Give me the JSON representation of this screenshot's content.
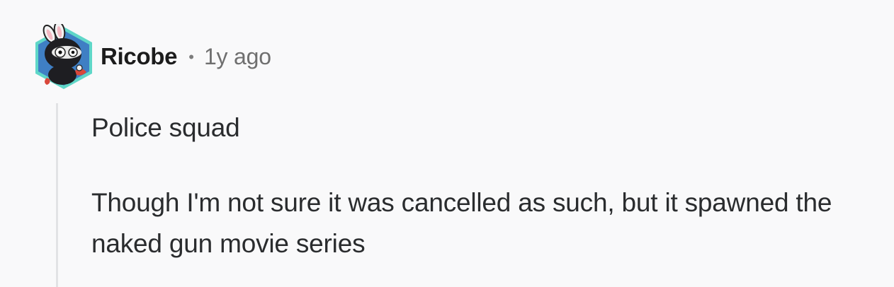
{
  "comment": {
    "author": "Ricobe",
    "separator": "•",
    "timestamp": "1y ago",
    "paragraphs": [
      "Police squad",
      "Though I'm not sure it was cancelled as such, but it spawned the naked gun movie series"
    ]
  },
  "colors": {
    "background": "#f9f9fa",
    "author": "#1c1c1c",
    "meta": "#6f6f6f",
    "body_text": "#2a2c2e",
    "thread_line": "#e2e3e5",
    "avatar_hex_border": "#5fd7c8",
    "avatar_hex_fill": "#3f7fc4"
  },
  "icons": {
    "avatar": "ninja-bunny-avatar-icon"
  }
}
